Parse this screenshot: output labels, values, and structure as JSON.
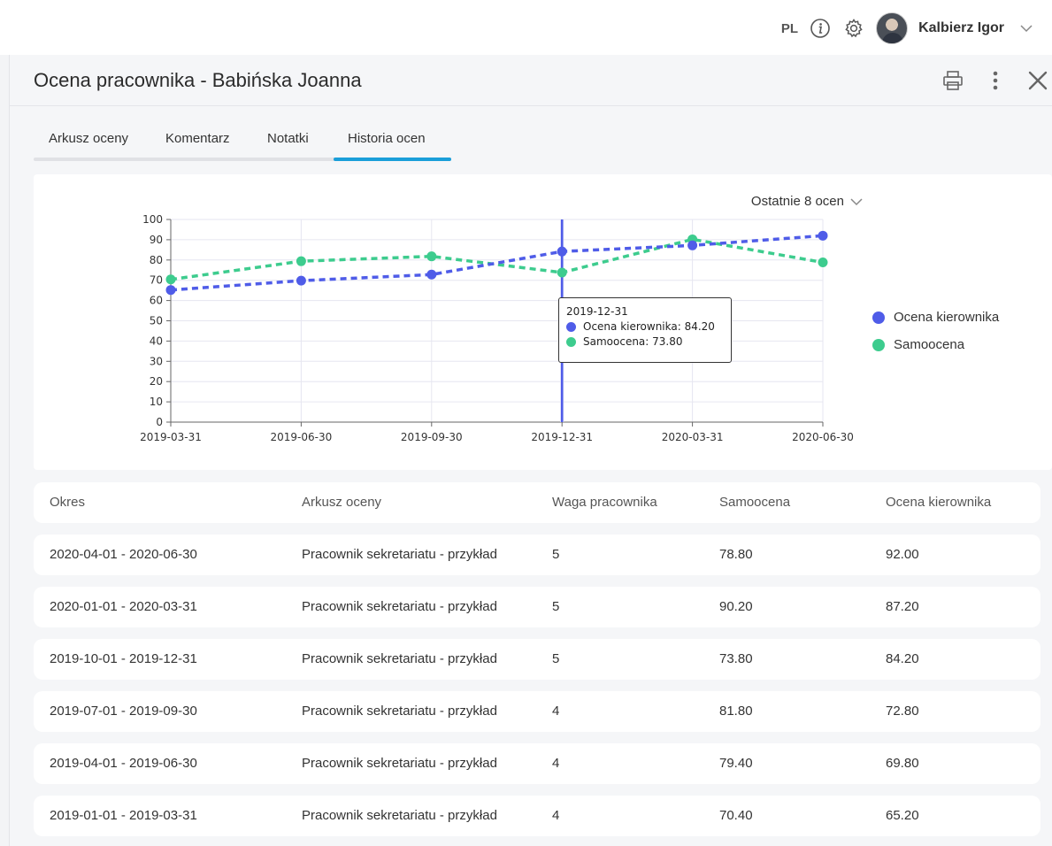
{
  "topbar": {
    "lang": "PL",
    "icons": [
      "info-icon",
      "gear-icon"
    ],
    "user_name": "Kalbierz Igor"
  },
  "panel": {
    "title": "Ocena pracownika - Babińska Joanna",
    "actions": [
      "print-icon",
      "more-vert-icon",
      "close-icon"
    ]
  },
  "tabs": [
    {
      "label": "Arkusz oceny"
    },
    {
      "label": "Komentarz"
    },
    {
      "label": "Notatki"
    },
    {
      "label": "Historia ocen",
      "active": true
    }
  ],
  "range_select": {
    "value": "Ostatnie 8 ocen"
  },
  "colors": {
    "manager": "#4f5ce8",
    "self": "#3dcc8e",
    "tab_active": "#1a9ed9"
  },
  "chart_data": {
    "type": "line",
    "x": [
      "2019-03-31",
      "2019-06-30",
      "2019-09-30",
      "2019-12-31",
      "2020-03-31",
      "2020-06-30"
    ],
    "series": [
      {
        "name": "Ocena kierownika",
        "values": [
          65.2,
          69.8,
          72.8,
          84.2,
          87.2,
          92.0
        ]
      },
      {
        "name": "Samoocena",
        "values": [
          70.4,
          79.4,
          81.8,
          73.8,
          90.2,
          78.8
        ]
      }
    ],
    "ylim": [
      0,
      100
    ],
    "yticks": [
      "0",
      "10",
      "20",
      "30",
      "40",
      "50",
      "60",
      "70",
      "80",
      "90",
      "100"
    ],
    "grid": true,
    "legend": "right",
    "tooltip": {
      "title": "2019-12-31",
      "lines": [
        "Ocena kierownika: 84.20",
        "Samoocena: 73.80"
      ]
    }
  },
  "table": {
    "headers": [
      "Okres",
      "Arkusz oceny",
      "Waga pracownika",
      "Samoocena",
      "Ocena kierownika"
    ],
    "rows": [
      [
        "2020-04-01 - 2020-06-30",
        "Pracownik sekretariatu - przykład",
        "5",
        "78.80",
        "92.00"
      ],
      [
        "2020-01-01 - 2020-03-31",
        "Pracownik sekretariatu - przykład",
        "5",
        "90.20",
        "87.20"
      ],
      [
        "2019-10-01 - 2019-12-31",
        "Pracownik sekretariatu - przykład",
        "5",
        "73.80",
        "84.20"
      ],
      [
        "2019-07-01 - 2019-09-30",
        "Pracownik sekretariatu - przykład",
        "4",
        "81.80",
        "72.80"
      ],
      [
        "2019-04-01 - 2019-06-30",
        "Pracownik sekretariatu - przykład",
        "4",
        "79.40",
        "69.80"
      ],
      [
        "2019-01-01 - 2019-03-31",
        "Pracownik sekretariatu - przykład",
        "4",
        "70.40",
        "65.20"
      ]
    ]
  }
}
